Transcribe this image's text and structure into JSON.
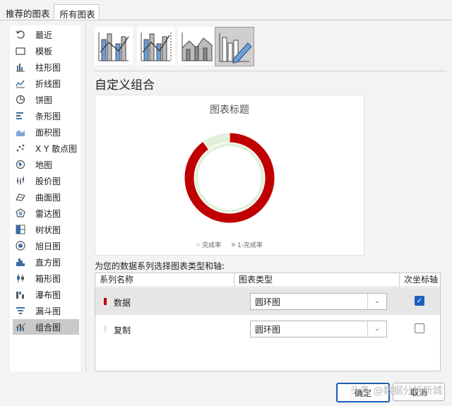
{
  "tabs": [
    "推荐的图表",
    "所有图表"
  ],
  "sidebar": {
    "items": [
      {
        "label": "最近",
        "icon": "recent-icon"
      },
      {
        "label": "模板",
        "icon": "folder-icon"
      },
      {
        "label": "柱形图",
        "icon": "column-chart-icon"
      },
      {
        "label": "折线图",
        "icon": "line-chart-icon"
      },
      {
        "label": "饼图",
        "icon": "pie-chart-icon"
      },
      {
        "label": "条形图",
        "icon": "bar-chart-icon"
      },
      {
        "label": "面积图",
        "icon": "area-chart-icon"
      },
      {
        "label": "X Y 散点图",
        "icon": "scatter-chart-icon"
      },
      {
        "label": "地图",
        "icon": "map-chart-icon"
      },
      {
        "label": "股价图",
        "icon": "stock-chart-icon"
      },
      {
        "label": "曲面图",
        "icon": "surface-chart-icon"
      },
      {
        "label": "雷达图",
        "icon": "radar-chart-icon"
      },
      {
        "label": "树状图",
        "icon": "treemap-chart-icon"
      },
      {
        "label": "旭日图",
        "icon": "sunburst-chart-icon"
      },
      {
        "label": "直方图",
        "icon": "histogram-chart-icon"
      },
      {
        "label": "箱形图",
        "icon": "box-whisker-chart-icon"
      },
      {
        "label": "瀑布图",
        "icon": "waterfall-chart-icon"
      },
      {
        "label": "漏斗图",
        "icon": "funnel-chart-icon"
      },
      {
        "label": "组合图",
        "icon": "combo-chart-icon"
      }
    ],
    "selected_index": 18
  },
  "main": {
    "section_title": "自定义组合",
    "prompt": "为您的数据系列选择图表类型和轴:"
  },
  "preview": {
    "chart_title": "图表标题"
  },
  "chart_data": {
    "type": "pie",
    "subtype": "doughnut",
    "title": "图表标题",
    "series": [
      {
        "name": "完成率",
        "color": "#c00000",
        "value": 0.9
      },
      {
        "name": "1-完成率",
        "color": "#e2efda",
        "value": 0.1
      }
    ]
  },
  "grid": {
    "headers": [
      "系列名称",
      "图表类型",
      "次坐标轴"
    ],
    "rows": [
      {
        "name": "数据",
        "chart_type": "圆环图",
        "secondary_axis": true,
        "color": "#c00000"
      },
      {
        "name": "复制",
        "chart_type": "圆环图",
        "secondary_axis": false,
        "color": "#e2efda"
      }
    ]
  },
  "buttons": {
    "ok": "确定",
    "cancel": "取消"
  },
  "watermark": "头条 @数据分析新城"
}
